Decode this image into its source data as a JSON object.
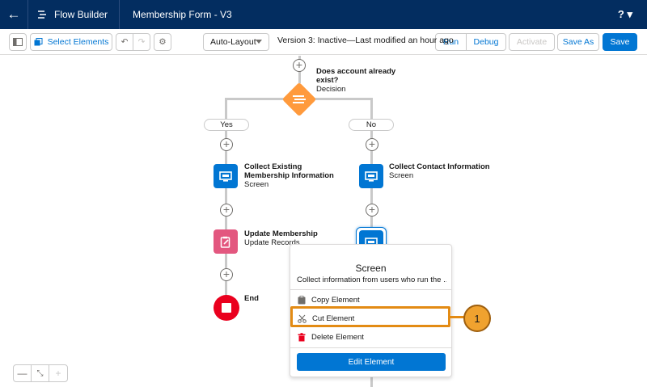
{
  "header": {
    "app_name": "Flow Builder",
    "flow_title": "Membership Form - V3",
    "help_label": "? ▾"
  },
  "toolbar": {
    "select_elements": "Select Elements",
    "layout_mode": "Auto-Layout",
    "version_status": "Version 3: Inactive—Last modified an hour ago",
    "run": "Run",
    "debug": "Debug",
    "activate": "Activate",
    "save_as": "Save As",
    "save": "Save"
  },
  "flow": {
    "decision": {
      "title": "Does account already exist?",
      "type": "Decision"
    },
    "branch_yes": "Yes",
    "branch_no": "No",
    "collect_existing": {
      "title": "Collect Existing Membership Information",
      "type": "Screen"
    },
    "collect_contact": {
      "title": "Collect Contact Information",
      "type": "Screen"
    },
    "update_membership": {
      "title": "Update Membership",
      "type": "Update Records"
    },
    "end": "End"
  },
  "context_menu": {
    "title": "Screen",
    "subtitle": "Collect information from users who run the ...",
    "items": [
      "Copy Element",
      "Cut Element",
      "Delete Element"
    ],
    "edit_button": "Edit Element"
  },
  "callout": {
    "number": "1"
  },
  "colors": {
    "brand": "#0176d3",
    "header": "#032d60",
    "decision": "#ff9a3c",
    "update": "#e3577f",
    "end": "#ea001e",
    "callout": "#e38b14"
  }
}
